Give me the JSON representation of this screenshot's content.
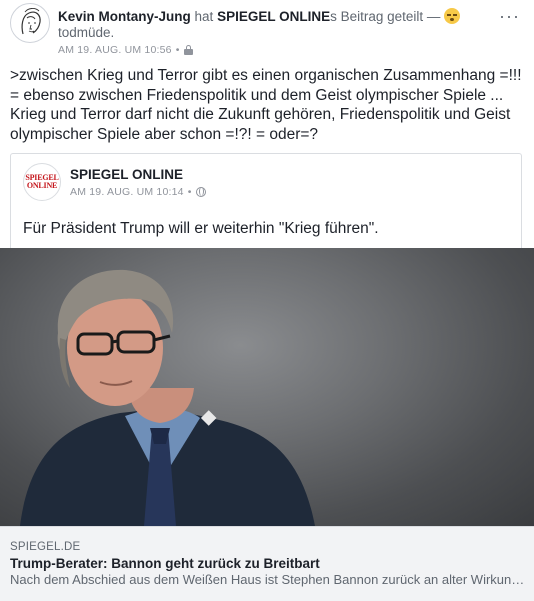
{
  "post": {
    "author": "Kevin Montany-Jung",
    "shared_word": "hat",
    "shared_page": "SPIEGEL ONLINE",
    "shared_suffix": "s Beitrag geteilt —",
    "feeling_icon": "sleepy-face-emoji",
    "feeling": "todmüde.",
    "timestamp": "AM 19. AUG. UM 10:56",
    "separator": "•",
    "privacy_icon": "lock-icon",
    "more_label": "···",
    "text": ">zwischen Krieg und Terror gibt es einen organischen Zusammenhang =!!! = ebenso zwischen Friedenspolitik und dem Geist olympischer Spiele ... Krieg und Terror darf nicht die Zukunft gehören, Friedenspolitik und Geist olympischer Spiele aber schon =!?! = oder=?"
  },
  "shared": {
    "page_name": "SPIEGEL ONLINE",
    "logo_line1": "SPIEGEL",
    "logo_line2": "ONLINE",
    "timestamp": "AM 19. AUG. UM 10:14",
    "separator": "•",
    "privacy_icon": "globe-icon",
    "text": "Für Präsident Trump will er weiterhin \"Krieg führen\"."
  },
  "link": {
    "domain": "SPIEGEL.DE",
    "title": "Trump-Berater: Bannon geht zurück zu Breitbart",
    "description": "Nach dem Abschied aus dem Weißen Haus ist Stephen Bannon zurück an alter Wirkungsstätte"
  },
  "colors": {
    "text": "#1d2129",
    "secondary": "#606770",
    "meta": "#90949c",
    "spiegel_red": "#c4161c",
    "caption_bg": "#f2f3f5"
  }
}
